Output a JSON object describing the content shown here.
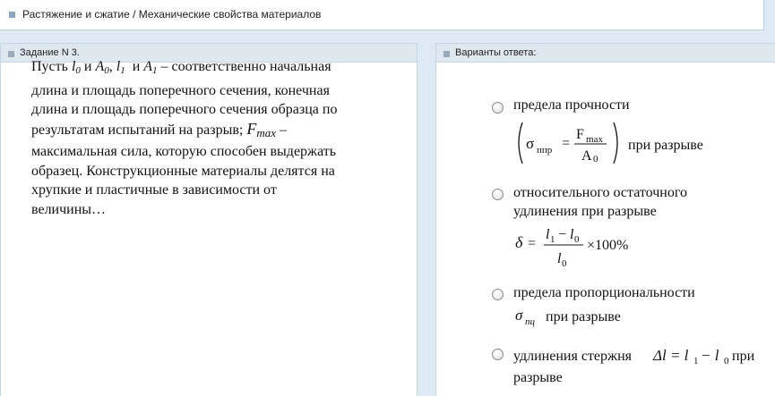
{
  "breadcrumb": "Растяжение и сжатие / Механические свойства материалов",
  "task_panel": {
    "title": "Задание N 3.",
    "text_pust": "Пусть",
    "l0": "l",
    "sub0": "0",
    "and1": "и",
    "A0": "A",
    "subA0": "0",
    "comma": ",",
    "l1": "l",
    "sub1": "1",
    "and2": "и",
    "A1": "A",
    "subA1": "1",
    "line1_rest": " – соответственно начальная",
    "line2": "длина и площадь поперечного сечения, конечная",
    "line3": "длина и площадь поперечного сечения образца по",
    "line4_start": "результатам испытаний на разрыв;",
    "F": "F",
    "Fsub": "max",
    "line4_end": " –",
    "line5": "максимальная сила, которую способен выдержать",
    "line6": "образец. Конструкционные материалы делятся на",
    "line7": "хрупкие и пластичные в зависимости от",
    "line8": "величины…"
  },
  "answers_panel": {
    "title": "Варианты ответа:",
    "options": [
      {
        "line1": "предела прочности",
        "sigma": "σ",
        "sigma_sub": "ппр",
        "frac_num": "F",
        "frac_num_sub": "max",
        "frac_den": "A",
        "frac_den_sub": "0",
        "suffix": "при разрыве"
      },
      {
        "line1": "относительного остаточного",
        "line2": "удлинения при разрыве",
        "delta": "δ",
        "num_l1": "l",
        "num_l1_sub": "1",
        "num_minus": "−",
        "num_l0": "l",
        "num_l0_sub": "0",
        "den_l0": "l",
        "den_l0_sub": "0",
        "times": "×100%"
      },
      {
        "line1": "предела пропорциональности",
        "sigma": "σ",
        "sigma_sub": "пц",
        "suffix": "при разрыве"
      },
      {
        "line1_start": "удлинения стержня",
        "formula": "Δl = l",
        "f_sub1": "1",
        "f_minus": " − l",
        "f_sub0": "0",
        "line1_end": "при",
        "line2": "разрыве"
      }
    ]
  }
}
